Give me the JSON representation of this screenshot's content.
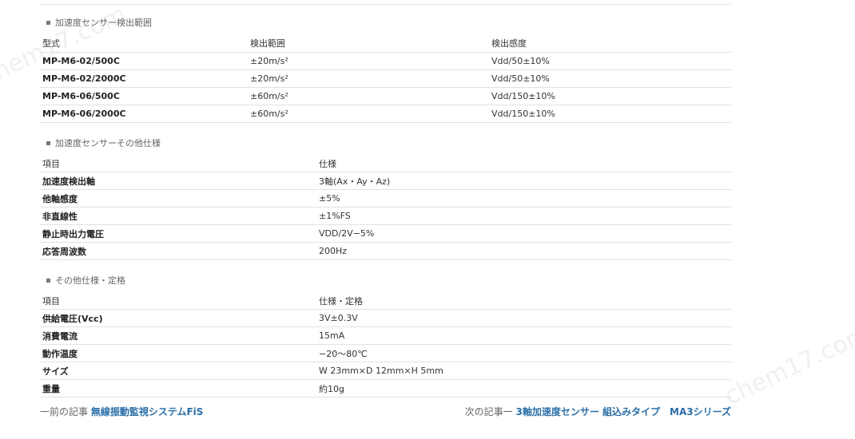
{
  "range_section": {
    "title": "加速度センサー検出範囲",
    "headers": [
      "型式",
      "検出範囲",
      "検出感度"
    ],
    "rows": [
      [
        "MP-M6-02/500C",
        "±20m/s²",
        "Vdd/50±10%"
      ],
      [
        "MP-M6-02/2000C",
        "±20m/s²",
        "Vdd/50±10%"
      ],
      [
        "MP-M6-06/500C",
        "±60m/s²",
        "Vdd/150±10%"
      ],
      [
        "MP-M6-06/2000C",
        "±60m/s²",
        "Vdd/150±10%"
      ]
    ]
  },
  "other_spec_section": {
    "title": "加速度センサーその他仕様",
    "headers": [
      "項目",
      "仕様"
    ],
    "rows": [
      [
        "加速度検出軸",
        "3軸(Ax・Ay・Az)"
      ],
      [
        "他軸感度",
        "±5%"
      ],
      [
        "非直線性",
        "±1%FS"
      ],
      [
        "静止時出力電圧",
        "VDD/2V−5%"
      ],
      [
        "応答周波数",
        "200Hz"
      ]
    ]
  },
  "misc_section": {
    "title": "その他仕様・定格",
    "headers": [
      "項目",
      "仕様・定格"
    ],
    "rows": [
      [
        "供給電圧(Vcc)",
        "3V±0.3V"
      ],
      [
        "消費電流",
        "15mA"
      ],
      [
        "動作温度",
        "−20～80℃"
      ],
      [
        "サイズ",
        "W 23mm×D 12mm×H 5mm"
      ],
      [
        "重量",
        "約10g"
      ]
    ]
  },
  "nav": {
    "prev_label": "一前の記事",
    "prev_link": "無線振動監視システムFiS",
    "next_label": "次の記事一",
    "next_link": "3軸加速度センサー 組込みタイプ　MA3シリーズ"
  },
  "watermark": "chem17.com",
  "colors": {
    "link": "#2b6fa8",
    "rule": "#e2e2e2"
  }
}
